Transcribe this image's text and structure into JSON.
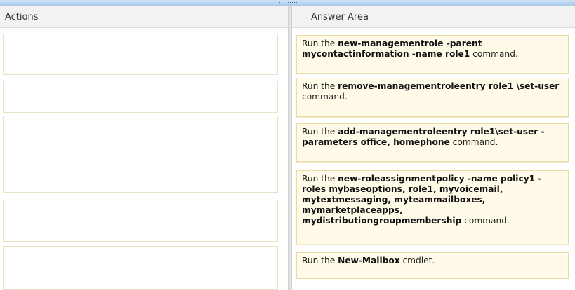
{
  "headers": {
    "actions": "Actions",
    "answer_area": "Answer Area"
  },
  "answer_cards": [
    [
      "Run the ",
      "new-managementrole -parent mycontactinformation -name role1",
      " command."
    ],
    [
      "Run the ",
      "remove-managementroleentry role1 \\set-user",
      " command."
    ],
    [
      "Run the ",
      "add-managementroleentry role1\\set-user -parameters office, homephone",
      " command."
    ],
    [
      "Run the ",
      "new-roleassignmentpolicy -name policy1 -roles mybaseoptions, role1, myvoicemail, mytextmessaging, myteammailboxes, mymarketplaceapps, mydistributiongroupmembership",
      " command."
    ],
    [
      "Run the ",
      "New-Mailbox",
      " cmdlet."
    ]
  ]
}
